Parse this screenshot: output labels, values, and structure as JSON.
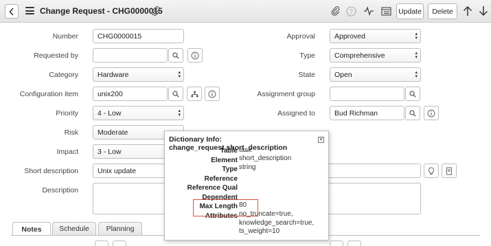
{
  "header": {
    "title": "Change Request - CHG0000015",
    "buttons": {
      "update": "Update",
      "delete": "Delete"
    }
  },
  "form": {
    "left": [
      {
        "label": "Number",
        "value": "CHG0000015"
      },
      {
        "label": "Requested by",
        "value": ""
      },
      {
        "label": "Category",
        "value": "Hardware"
      },
      {
        "label": "Configuration item",
        "value": "unix200"
      },
      {
        "label": "Priority",
        "value": "4 - Low"
      },
      {
        "label": "Risk",
        "value": "Moderate"
      },
      {
        "label": "Impact",
        "value": "3 - Low"
      },
      {
        "label": "Short description",
        "value": "Unix update"
      },
      {
        "label": "Description",
        "value": ""
      }
    ],
    "right": [
      {
        "label": "Approval",
        "value": "Approved"
      },
      {
        "label": "Type",
        "value": "Comprehensive"
      },
      {
        "label": "State",
        "value": "Open"
      },
      {
        "label": "Assignment group",
        "value": ""
      },
      {
        "label": "Assigned to",
        "value": "Bud Richman"
      }
    ]
  },
  "popup": {
    "title": "Dictionary Info: change_request.short_description",
    "rows": [
      {
        "key": "Table",
        "value": "task"
      },
      {
        "key": "Element",
        "value": "short_description"
      },
      {
        "key": "Type",
        "value": "string"
      },
      {
        "key": "Reference",
        "value": ""
      },
      {
        "key": "Reference Qual",
        "value": ""
      },
      {
        "key": "Dependent",
        "value": ""
      },
      {
        "key": "Max Length",
        "value": "80"
      },
      {
        "key": "Attributes",
        "value": "no_truncate=true,\nknowledge_search=true,\nts_weight=10"
      }
    ]
  },
  "tabs": [
    "Notes",
    "Schedule",
    "Planning"
  ],
  "colors": {
    "highlight_box": "#d9503f"
  }
}
